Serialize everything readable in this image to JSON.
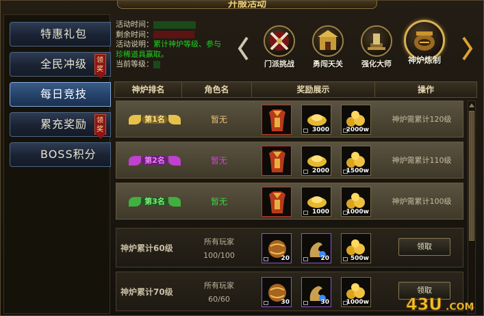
{
  "colors": {
    "accent_gold": "#d9b257",
    "green_value": "#1fd11f",
    "tab_blue": "#234066",
    "badge_red": "#8e1512"
  },
  "title": "开服活动",
  "sidebar": {
    "items": [
      {
        "label": "特惠礼包",
        "badge": "",
        "active": false
      },
      {
        "label": "全民冲级",
        "badge": "领奖",
        "active": false
      },
      {
        "label": "每日竞技",
        "badge": "",
        "active": true
      },
      {
        "label": "累充奖励",
        "badge": "领奖",
        "active": false
      },
      {
        "label": "BOSS积分",
        "badge": "",
        "active": false
      }
    ]
  },
  "info": {
    "time_label": "活动时间：",
    "remain_label": "剩余时间：",
    "desc_label": "活动说明：",
    "desc_text": "累计神炉等级、参与",
    "desc_text2": "珍稀道具赢取。",
    "level_label": "当前等级："
  },
  "activities": [
    {
      "label": "门派挑战",
      "icon": "crossed-swords-icon"
    },
    {
      "label": "勇闯天关",
      "icon": "gate-icon"
    },
    {
      "label": "强化大师",
      "icon": "anvil-icon"
    },
    {
      "label": "神炉炼制",
      "icon": "cauldron-icon",
      "selected": true
    }
  ],
  "table": {
    "headers": [
      "神炉排名",
      "角色名",
      "奖励展示",
      "操作"
    ],
    "rank_rows": [
      {
        "rank": "第1名",
        "role": "暂无",
        "rank_color": "#e6c24a",
        "role_color": "#e8c070",
        "rewards": [
          {
            "icon": "golden-armor-icon",
            "qty": ""
          },
          {
            "icon": "gold-ingot-icon",
            "qty": "3000"
          },
          {
            "icon": "gold-coins-icon",
            "qty": "2000w"
          }
        ],
        "requirement": "神炉需累计120级"
      },
      {
        "rank": "第2名",
        "role": "暂无",
        "rank_color": "#c040d0",
        "role_color": "#d040d8",
        "rewards": [
          {
            "icon": "golden-armor-icon",
            "qty": ""
          },
          {
            "icon": "gold-ingot-icon",
            "qty": "2000"
          },
          {
            "icon": "gold-coins-icon",
            "qty": "1500w"
          }
        ],
        "requirement": "神炉需累计110级"
      },
      {
        "rank": "第3名",
        "role": "暂无",
        "rank_color": "#40b040",
        "role_color": "#3fd23f",
        "rewards": [
          {
            "icon": "golden-armor-icon",
            "qty": ""
          },
          {
            "icon": "gold-ingot-icon",
            "qty": "1000"
          },
          {
            "icon": "gold-coins-icon",
            "qty": "1000w"
          }
        ],
        "requirement": "神炉需累计100级"
      }
    ],
    "level_rows": [
      {
        "level": "神炉累计60级",
        "players_label": "所有玩家",
        "progress": "100/100",
        "rewards": [
          {
            "icon": "bronze-orb-icon",
            "qty": "20"
          },
          {
            "icon": "dragon-statue-icon",
            "qty": "20"
          },
          {
            "icon": "gold-coins-icon",
            "qty": "500w"
          }
        ],
        "button": "领取"
      },
      {
        "level": "神炉累计70级",
        "players_label": "所有玩家",
        "progress": "60/60",
        "rewards": [
          {
            "icon": "bronze-orb-icon",
            "qty": "30"
          },
          {
            "icon": "dragon-statue-icon",
            "qty": "30"
          },
          {
            "icon": "gold-coins-icon",
            "qty": "1000w"
          }
        ],
        "button": "领取"
      }
    ]
  },
  "watermark": "43U.COM"
}
